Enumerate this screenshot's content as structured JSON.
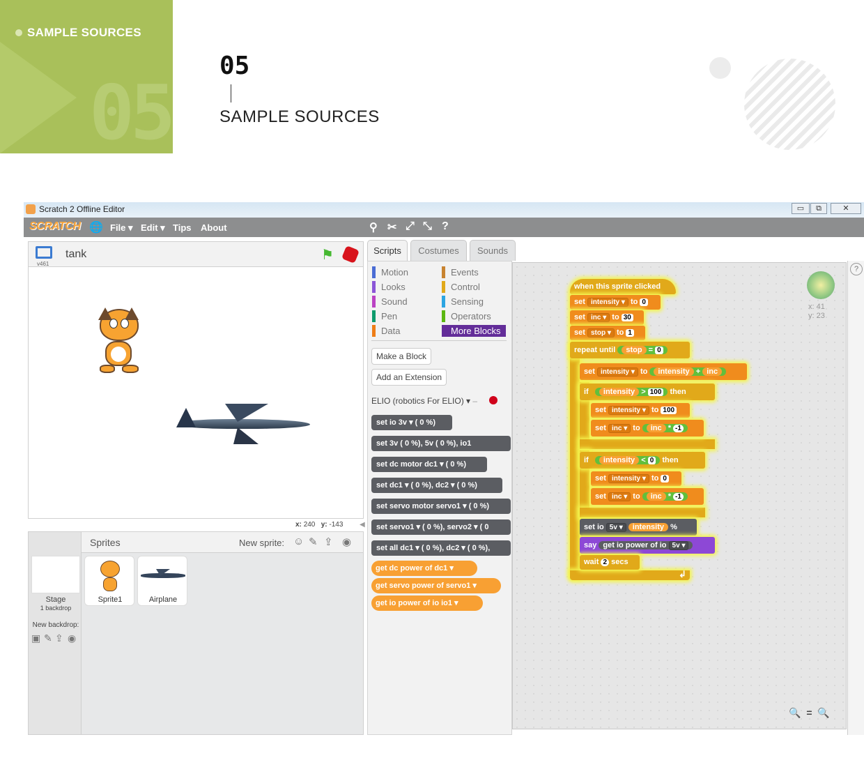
{
  "header": {
    "badge_label": "SAMPLE SOURCES",
    "badge_number": "05",
    "section_number": "05",
    "section_title": "SAMPLE SOURCES"
  },
  "window": {
    "title": "Scratch 2 Offline Editor",
    "minimize": "▭",
    "maximize": "⧉",
    "close": "✕"
  },
  "menu": {
    "logo": "SCRATCH",
    "file": "File ▾",
    "edit": "Edit ▾",
    "tips": "Tips",
    "about": "About"
  },
  "stage": {
    "sprite_name": "tank",
    "version": "v461",
    "x_label": "x:",
    "x_value": "240",
    "y_label": "y:",
    "y_value": "-143"
  },
  "sprites_panel": {
    "title": "Sprites",
    "new_sprite": "New sprite:",
    "stage_label": "Stage",
    "stage_sub": "1 backdrop",
    "new_backdrop": "New backdrop:",
    "items": [
      {
        "name": "Sprite1"
      },
      {
        "name": "Airplane"
      }
    ]
  },
  "tabs": {
    "scripts": "Scripts",
    "costumes": "Costumes",
    "sounds": "Sounds"
  },
  "categories": {
    "left": [
      {
        "label": "Motion",
        "color": "#4a6cd4"
      },
      {
        "label": "Looks",
        "color": "#8a55d7"
      },
      {
        "label": "Sound",
        "color": "#bb42c3"
      },
      {
        "label": "Pen",
        "color": "#0e9a6c"
      },
      {
        "label": "Data",
        "color": "#ee7d16"
      }
    ],
    "right": [
      {
        "label": "Events",
        "color": "#c88330"
      },
      {
        "label": "Control",
        "color": "#e1a91a"
      },
      {
        "label": "Sensing",
        "color": "#2ca5e2"
      },
      {
        "label": "Operators",
        "color": "#5cb712"
      },
      {
        "label": "More Blocks",
        "color": "#632d99"
      }
    ]
  },
  "palette": {
    "make_block": "Make a Block",
    "add_extension": "Add an Extension",
    "extension_name": "ELIO (robotics For ELIO)",
    "blocks": [
      "set io 3v ▾ ( 0 %)",
      "set 3v ( 0 %), 5v ( 0 %), io1",
      "set dc motor dc1 ▾ ( 0 %)",
      "set dc1 ▾ ( 0 %), dc2 ▾ ( 0 %)",
      "set servo motor servo1 ▾ ( 0 %)",
      "set servo1 ▾ ( 0 %), servo2 ▾ ( 0",
      "set all dc1 ▾ ( 0 %), dc2 ▾ ( 0 %),",
      "get dc power of dc1 ▾",
      "get servo power of servo1 ▾",
      "get io power of io io1 ▾"
    ]
  },
  "script": {
    "hat": "when this sprite clicked",
    "set1": {
      "kw": "set",
      "var": "intensity ▾",
      "to": "to",
      "val": "0"
    },
    "set2": {
      "kw": "set",
      "var": "inc ▾",
      "to": "to",
      "val": "30"
    },
    "set3": {
      "kw": "set",
      "var": "stop ▾",
      "to": "to",
      "val": "1"
    },
    "repeat": {
      "kw": "repeat until",
      "var": "stop",
      "op": "=",
      "val": "0"
    },
    "set4": {
      "kw": "set",
      "var": "intensity ▾",
      "to": "to",
      "a": "intensity",
      "op": "+",
      "b": "inc"
    },
    "if1": {
      "kw": "if",
      "var": "intensity",
      "op": ">",
      "val": "100",
      "then": "then"
    },
    "set5": {
      "kw": "set",
      "var": "intensity ▾",
      "to": "to",
      "val": "100"
    },
    "set6": {
      "kw": "set",
      "var": "inc ▾",
      "to": "to",
      "a": "inc",
      "op": "*",
      "b": "-1"
    },
    "if2": {
      "kw": "if",
      "var": "intensity",
      "op": "<",
      "val": "0",
      "then": "then"
    },
    "set7": {
      "kw": "set",
      "var": "intensity ▾",
      "to": "to",
      "val": "0"
    },
    "set8": {
      "kw": "set",
      "var": "inc ▾",
      "to": "to",
      "a": "inc",
      "op": "*",
      "b": "-1"
    },
    "setio": {
      "kw": "set io",
      "var": "5v ▾",
      "val": "intensity",
      "pct": "%"
    },
    "say": {
      "kw": "say",
      "inner": "get io power of io",
      "var": "5v ▾"
    },
    "wait": {
      "kw": "wait",
      "val": "2",
      "unit": "secs"
    },
    "end": "↲"
  },
  "sprite_info": {
    "x": "x: 41",
    "y": "y: 23"
  },
  "zoom": {
    "out": "🔍",
    "reset": "=",
    "in": "🔍"
  }
}
